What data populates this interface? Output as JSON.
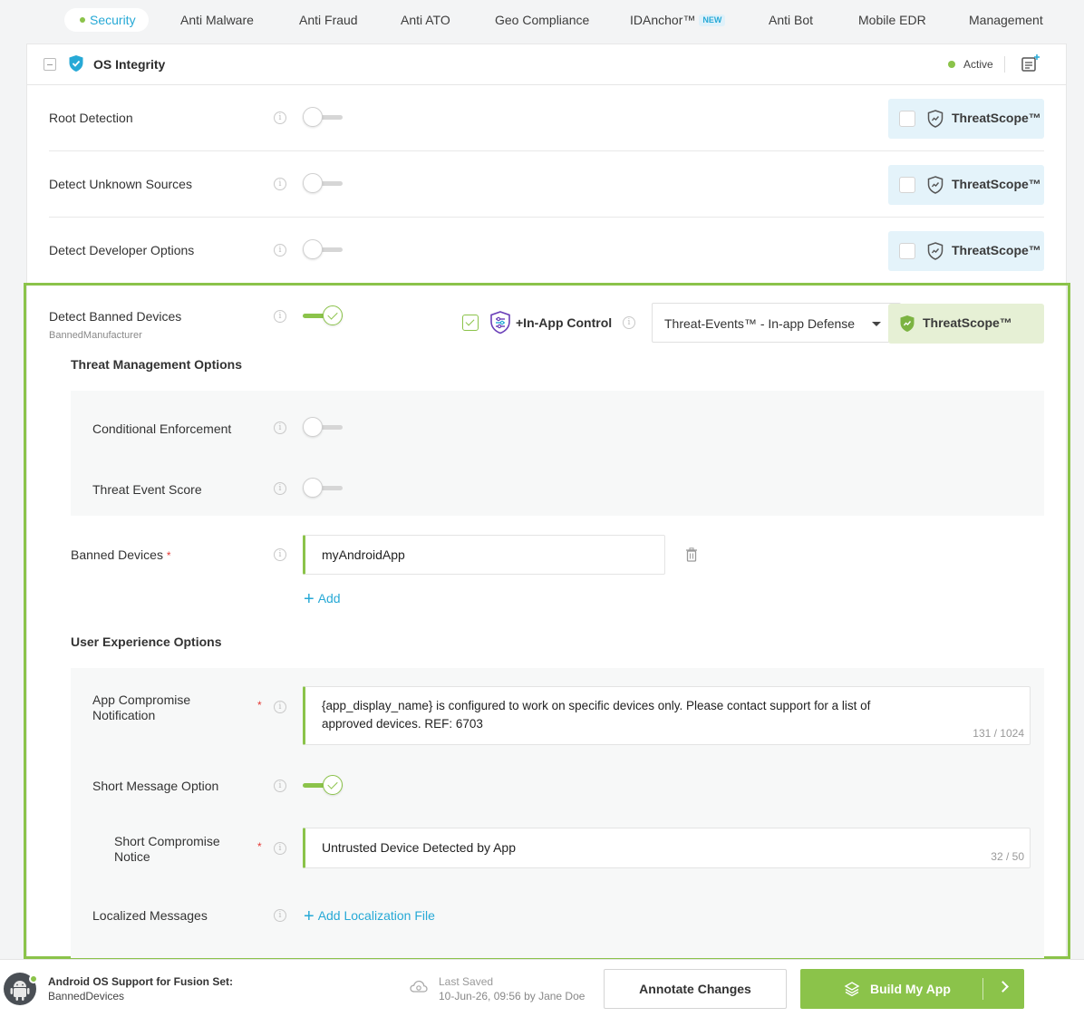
{
  "nav": {
    "tabs": [
      {
        "label": "Security"
      },
      {
        "label": "Anti Malware"
      },
      {
        "label": "Anti Fraud"
      },
      {
        "label": "Anti ATO"
      },
      {
        "label": "Geo Compliance"
      },
      {
        "label": "IDAnchor™",
        "badge": "NEW"
      },
      {
        "label": "Anti Bot"
      },
      {
        "label": "Mobile EDR"
      },
      {
        "label": "Management"
      }
    ]
  },
  "card": {
    "title": "OS Integrity",
    "status": "Active"
  },
  "rows": [
    {
      "label": "Root Detection",
      "threatscope": "ThreatScope™"
    },
    {
      "label": "Detect Unknown Sources",
      "threatscope": "ThreatScope™"
    },
    {
      "label": "Detect Developer Options",
      "threatscope": "ThreatScope™"
    }
  ],
  "banned": {
    "label": "Detect Banned Devices",
    "sublabel": "BannedManufacturer",
    "inapp_label": "+In-App Control",
    "select_value": "Threat-Events™ - In-app Defense",
    "threatscope": "ThreatScope™",
    "tm_title": "Threat Management Options",
    "conditional_label": "Conditional Enforcement",
    "score_label": "Threat Event Score",
    "banned_devices_label": "Banned Devices",
    "required_mark": "*",
    "banned_value": "myAndroidApp",
    "add_label": "Add",
    "ux_title": "User Experience Options",
    "app_notif_label": "App Compromise Notification",
    "app_notif_value": "{app_display_name} is configured to work on specific devices only. Please contact support for a list of approved devices. REF: 6703",
    "app_notif_counter": "131 / 1024",
    "short_msg_label": "Short Message Option",
    "short_notice_label": "Short Compromise Notice",
    "short_notice_value": "Untrusted Device Detected by App",
    "short_notice_counter": "32 / 50",
    "localized_label": "Localized Messages",
    "add_localization": "Add Localization File"
  },
  "footer": {
    "title": "Android OS Support for Fusion Set:",
    "subtitle": "BannedDevices",
    "saved_label": "Last Saved",
    "saved_value": "10-Jun-26, 09:56 by Jane Doe",
    "annotate_label": "Annotate Changes",
    "build_label": "Build My App"
  },
  "colors": {
    "accent_green": "#8bc34a",
    "accent_blue": "#27a9d6",
    "threatscope_bg": "#e4f3fa"
  }
}
